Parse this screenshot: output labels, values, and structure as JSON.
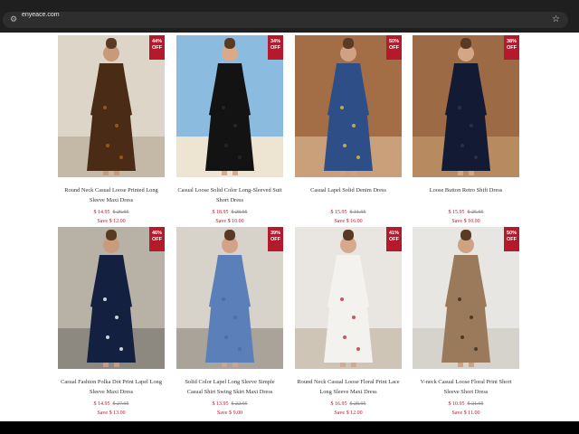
{
  "browser": {
    "url": "enyeace.com"
  },
  "products": [
    {
      "title": "Round Neck Casual Loose Printed Long Sleeve Maxi Dress",
      "price": "$ 14.95",
      "old_price": "$ 26.95",
      "save": "Save $ 12.00",
      "discount_pct": "44%",
      "discount_word": "OFF",
      "palette": {
        "bg": "#ddd6c8",
        "floor": "#c4b8a6",
        "dress": "#4a2c16",
        "accent": "#a7611f",
        "skin": "#c99a7a"
      }
    },
    {
      "title": "Casual Loose Solid Color Long-Sleeved Suit Short Dress",
      "price": "$ 18.95",
      "old_price": "$ 28.95",
      "save": "Save $ 10.00",
      "discount_pct": "34%",
      "discount_word": "OFF",
      "palette": {
        "bg": "#8bbce0",
        "floor": "#eee4d2",
        "dress": "#131313",
        "accent": "#2b2b2b",
        "skin": "#d8a98b"
      }
    },
    {
      "title": "Casual Lapel Solid Denim Dress",
      "price": "$ 15.95",
      "old_price": "$ 31.95",
      "save": "Save $ 16.00",
      "discount_pct": "50%",
      "discount_word": "OFF",
      "palette": {
        "bg": "#a36d45",
        "floor": "#c9a07a",
        "dress": "#2d4e86",
        "accent": "#e3c13b",
        "skin": "#d1a184"
      }
    },
    {
      "title": "Loose Button Retro Shift Dress",
      "price": "$ 15.95",
      "old_price": "$ 25.95",
      "save": "Save $ 10.00",
      "discount_pct": "38%",
      "discount_word": "OFF",
      "palette": {
        "bg": "#9c6a44",
        "floor": "#b88a60",
        "dress": "#131a33",
        "accent": "#2b3458",
        "skin": "#d3a685"
      }
    },
    {
      "title": "Casual Fashion Polka Dot Print Lapel Long Sleeve Maxi Dress",
      "price": "$ 14.95",
      "old_price": "$ 27.95",
      "save": "Save $ 13.00",
      "discount_pct": "46%",
      "discount_word": "OFF",
      "palette": {
        "bg": "#b8b1a6",
        "floor": "#8d8880",
        "dress": "#14203f",
        "accent": "#ffffff",
        "skin": "#c89b7e"
      }
    },
    {
      "title": "Solid Color Lapel Long Sleeve Simple Casual Shirt Swing Skirt Maxi Dress",
      "price": "$ 13.95",
      "old_price": "$ 22.95",
      "save": "Save $ 9.00",
      "discount_pct": "39%",
      "discount_word": "OFF",
      "palette": {
        "bg": "#d7d2ca",
        "floor": "#a9a39a",
        "dress": "#5b7fb9",
        "accent": "#4a6aa3",
        "skin": "#d2a386"
      }
    },
    {
      "title": "Round Neck Casual Loose Floral Print Lace Long Sleeve Maxi Dress",
      "price": "$ 16.95",
      "old_price": "$ 28.95",
      "save": "Save $ 12.00",
      "discount_pct": "41%",
      "discount_word": "OFF",
      "palette": {
        "bg": "#e9e6e1",
        "floor": "#cfc5b6",
        "dress": "#f4f2ef",
        "accent": "#b8333c",
        "skin": "#d6a98d"
      }
    },
    {
      "title": "V-neck Casual Loose Floral Print Short Sleeve Short Dress",
      "price": "$ 10.95",
      "old_price": "$ 21.95",
      "save": "Save $ 11.00",
      "discount_pct": "50%",
      "discount_word": "OFF",
      "palette": {
        "bg": "#e8e6e2",
        "floor": "#d6d2cc",
        "dress": "#9a7a5a",
        "accent": "#3a2a1e",
        "skin": "#d0a284"
      }
    }
  ]
}
